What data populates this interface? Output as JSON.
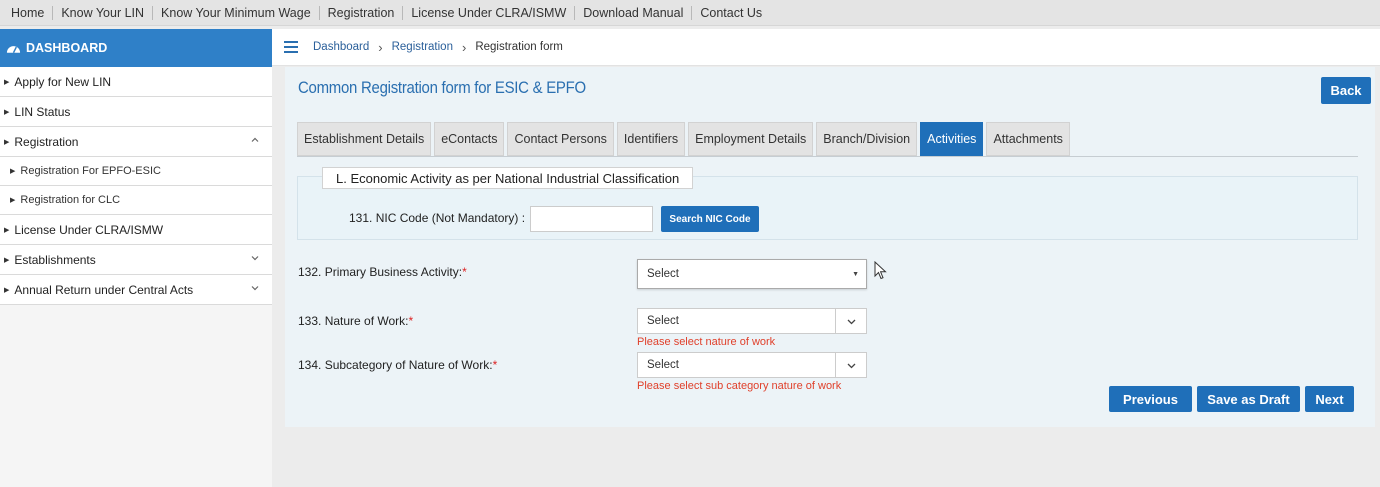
{
  "topnav": [
    "Home",
    "Know Your LIN",
    "Know Your Minimum Wage",
    "Registration",
    "License Under CLRA/ISMW",
    "Download Manual",
    "Contact Us"
  ],
  "sidebar": {
    "header": "DASHBOARD",
    "items": [
      {
        "label": "Apply for New LIN"
      },
      {
        "label": "LIN Status"
      },
      {
        "label": "Registration"
      },
      {
        "label": "Registration For EPFO-ESIC"
      },
      {
        "label": "Registration for CLC"
      },
      {
        "label": "License Under CLRA/ISMW"
      },
      {
        "label": "Establishments"
      },
      {
        "label": "Annual Return under Central Acts"
      }
    ]
  },
  "breadcrumb": [
    "Dashboard",
    "Registration",
    "Registration form"
  ],
  "form": {
    "title": "Common Registration form for ESIC & EPFO",
    "back_label": "Back"
  },
  "tabs": [
    "Establishment Details",
    "eContacts",
    "Contact Persons",
    "Identifiers",
    "Employment Details",
    "Branch/Division",
    "Activities",
    "Attachments"
  ],
  "active_tab": "Activities",
  "section": {
    "legend": "L. Economic Activity as per National Industrial Classification",
    "nic_label": "131. NIC Code (Not Mandatory) :",
    "nic_value": "",
    "search_label": "Search NIC Code"
  },
  "fields": {
    "primary": {
      "label": "132. Primary Business Activity:",
      "value": "Select"
    },
    "nature": {
      "label": "133. Nature of Work:",
      "value": "Select",
      "error": "Please select nature of work"
    },
    "subcategory": {
      "label": "134. Subcategory of Nature of Work:",
      "value": "Select",
      "error": "Please select sub category nature of work"
    },
    "required_mark": "*"
  },
  "buttons": {
    "previous": "Previous",
    "draft": "Save as Draft",
    "next": "Next"
  },
  "colors": {
    "accent": "#1f6fb9",
    "error": "#e0402b"
  }
}
